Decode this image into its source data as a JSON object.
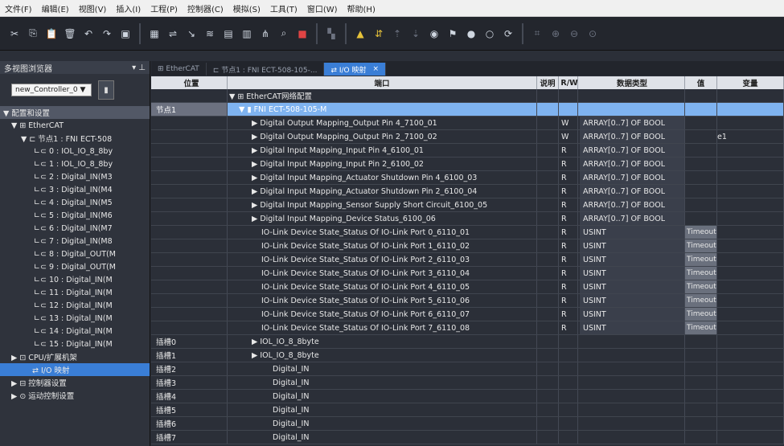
{
  "menu": [
    "文件(F)",
    "编辑(E)",
    "视图(V)",
    "插入(I)",
    "工程(P)",
    "控制器(C)",
    "模拟(S)",
    "工具(T)",
    "窗口(W)",
    "帮助(H)"
  ],
  "toolbar_icons": [
    "cut-icon",
    "copy-icon",
    "paste-icon",
    "delete-icon",
    "undo-icon",
    "redo-icon",
    "save-icon",
    "sep",
    "grid-icon",
    "cross-ref-icon",
    "jump-icon",
    "compare-icon",
    "build-icon",
    "program-icon",
    "hierarchy-icon",
    "find-icon",
    "stop-icon",
    "sep",
    "rebuild-icon",
    "sep",
    "warning-icon",
    "transfer-icon",
    "upload-icon",
    "download-icon",
    "monitor-icon",
    "force-icon",
    "online-icon",
    "offline-icon",
    "sync-icon",
    "sep",
    "fit-icon",
    "zoom-in-icon",
    "zoom-out-icon",
    "zoom-reset-icon"
  ],
  "sidebar": {
    "title": "多视图浏览器",
    "pin": "▾ ⊥",
    "controller": "new_Controller_0 ▼",
    "items": [
      {
        "label": "▼ 配置和设置",
        "indent": 4,
        "type": "section"
      },
      {
        "label": "▼ ⊞ EtherCAT",
        "indent": 14,
        "type": "normal"
      },
      {
        "label": "▼ ⊏ 节点1 : FNI ECT-508",
        "indent": 26,
        "type": "normal"
      },
      {
        "label": "∟⊂ 0 : IOL_IO_8_8by",
        "indent": 42,
        "type": "normal"
      },
      {
        "label": "∟⊂ 1 : IOL_IO_8_8by",
        "indent": 42,
        "type": "normal"
      },
      {
        "label": "∟⊂ 2 : Digital_IN(M3",
        "indent": 42,
        "type": "normal"
      },
      {
        "label": "∟⊂ 3 : Digital_IN(M4",
        "indent": 42,
        "type": "normal"
      },
      {
        "label": "∟⊂ 4 : Digital_IN(M5",
        "indent": 42,
        "type": "normal"
      },
      {
        "label": "∟⊂ 5 : Digital_IN(M6",
        "indent": 42,
        "type": "normal"
      },
      {
        "label": "∟⊂ 6 : Digital_IN(M7",
        "indent": 42,
        "type": "normal"
      },
      {
        "label": "∟⊂ 7 : Digital_IN(M8",
        "indent": 42,
        "type": "normal"
      },
      {
        "label": "∟⊂ 8 : Digital_OUT(M",
        "indent": 42,
        "type": "normal"
      },
      {
        "label": "∟⊂ 9 : Digital_OUT(M",
        "indent": 42,
        "type": "normal"
      },
      {
        "label": "∟⊂ 10 : Digital_IN(M",
        "indent": 42,
        "type": "normal"
      },
      {
        "label": "∟⊂ 11 : Digital_IN(M",
        "indent": 42,
        "type": "normal"
      },
      {
        "label": "∟⊂ 12 : Digital_IN(M",
        "indent": 42,
        "type": "normal"
      },
      {
        "label": "∟⊂ 13 : Digital_IN(M",
        "indent": 42,
        "type": "normal"
      },
      {
        "label": "∟⊂ 14 : Digital_IN(M",
        "indent": 42,
        "type": "normal"
      },
      {
        "label": "∟⊂ 15 : Digital_IN(M",
        "indent": 42,
        "type": "normal"
      },
      {
        "label": "▶ ⊡ CPU/扩展机架",
        "indent": 14,
        "type": "normal"
      },
      {
        "label": "⇄ I/O 映射",
        "indent": 40,
        "type": "selected"
      },
      {
        "label": "▶ ⊟ 控制器设置",
        "indent": 14,
        "type": "normal"
      },
      {
        "label": "▶ ⊙ 运动控制设置",
        "indent": 14,
        "type": "normal"
      }
    ]
  },
  "tabs": [
    {
      "label": "⊞ EtherCAT",
      "active": false
    },
    {
      "label": "⊏ 节点1 : FNI ECT-508-105-...",
      "active": false
    },
    {
      "label": "⇄ I/O 映射",
      "active": true,
      "close": "×"
    }
  ],
  "grid": {
    "headers": {
      "pos": "位置",
      "port": "端口",
      "desc": "说明",
      "rw": "R/W",
      "type": "数据类型",
      "val": "值",
      "var": "变量"
    },
    "rows": [
      {
        "pos": "",
        "port": "▼ ⊞ EtherCAT网络配置",
        "indent": 2,
        "rw": "",
        "type": "",
        "val": "",
        "var": ""
      },
      {
        "pos": "节点1",
        "port": "▼ ▮ FNI ECT-508-105-M",
        "indent": 14,
        "rw": "",
        "type": "",
        "val": "",
        "var": "",
        "sel": true
      },
      {
        "pos": "",
        "port": "▶ Digital Output Mapping_Output Pin 4_7100_01",
        "indent": 30,
        "rw": "W",
        "type": "ARRAY[0..7] OF BOOL",
        "val": "",
        "var": ""
      },
      {
        "pos": "",
        "port": "▶ Digital Output Mapping_Output Pin 2_7100_02",
        "indent": 30,
        "rw": "W",
        "type": "ARRAY[0..7] OF BOOL",
        "val": "",
        "var": "e1"
      },
      {
        "pos": "",
        "port": "▶ Digital Input Mapping_Input Pin 4_6100_01",
        "indent": 30,
        "rw": "R",
        "type": "ARRAY[0..7] OF BOOL",
        "val": "",
        "var": ""
      },
      {
        "pos": "",
        "port": "▶ Digital Input Mapping_Input Pin 2_6100_02",
        "indent": 30,
        "rw": "R",
        "type": "ARRAY[0..7] OF BOOL",
        "val": "",
        "var": ""
      },
      {
        "pos": "",
        "port": "▶ Digital Input Mapping_Actuator Shutdown Pin 4_6100_03",
        "indent": 30,
        "rw": "R",
        "type": "ARRAY[0..7] OF BOOL",
        "val": "",
        "var": ""
      },
      {
        "pos": "",
        "port": "▶ Digital Input Mapping_Actuator Shutdown Pin 2_6100_04",
        "indent": 30,
        "rw": "R",
        "type": "ARRAY[0..7] OF BOOL",
        "val": "",
        "var": ""
      },
      {
        "pos": "",
        "port": "▶ Digital Input Mapping_Sensor Supply Short Circuit_6100_05",
        "indent": 30,
        "rw": "R",
        "type": "ARRAY[0..7] OF BOOL",
        "val": "",
        "var": ""
      },
      {
        "pos": "",
        "port": "▶ Digital Input Mapping_Device Status_6100_06",
        "indent": 30,
        "rw": "R",
        "type": "ARRAY[0..7] OF BOOL",
        "val": "",
        "var": ""
      },
      {
        "pos": "",
        "port": "IO-Link Device State_Status Of IO-Link Port 0_6110_01",
        "indent": 42,
        "rw": "R",
        "type": "USINT",
        "val": "Timeout",
        "var": ""
      },
      {
        "pos": "",
        "port": "IO-Link Device State_Status Of IO-Link Port 1_6110_02",
        "indent": 42,
        "rw": "R",
        "type": "USINT",
        "val": "Timeout",
        "var": ""
      },
      {
        "pos": "",
        "port": "IO-Link Device State_Status Of IO-Link Port 2_6110_03",
        "indent": 42,
        "rw": "R",
        "type": "USINT",
        "val": "Timeout",
        "var": ""
      },
      {
        "pos": "",
        "port": "IO-Link Device State_Status Of IO-Link Port 3_6110_04",
        "indent": 42,
        "rw": "R",
        "type": "USINT",
        "val": "Timeout",
        "var": ""
      },
      {
        "pos": "",
        "port": "IO-Link Device State_Status Of IO-Link Port 4_6110_05",
        "indent": 42,
        "rw": "R",
        "type": "USINT",
        "val": "Timeout",
        "var": ""
      },
      {
        "pos": "",
        "port": "IO-Link Device State_Status Of IO-Link Port 5_6110_06",
        "indent": 42,
        "rw": "R",
        "type": "USINT",
        "val": "Timeout",
        "var": ""
      },
      {
        "pos": "",
        "port": "IO-Link Device State_Status Of IO-Link Port 6_6110_07",
        "indent": 42,
        "rw": "R",
        "type": "USINT",
        "val": "Timeout",
        "var": ""
      },
      {
        "pos": "",
        "port": "IO-Link Device State_Status Of IO-Link Port 7_6110_08",
        "indent": 42,
        "rw": "R",
        "type": "USINT",
        "val": "Timeout",
        "var": ""
      },
      {
        "pos": "插槽0",
        "port": "▶    IOL_IO_8_8byte",
        "indent": 30,
        "rw": "",
        "type": "",
        "val": "",
        "var": ""
      },
      {
        "pos": "插槽1",
        "port": "▶    IOL_IO_8_8byte",
        "indent": 30,
        "rw": "",
        "type": "",
        "val": "",
        "var": ""
      },
      {
        "pos": "插槽2",
        "port": "Digital_IN",
        "indent": 56,
        "rw": "",
        "type": "",
        "val": "",
        "var": ""
      },
      {
        "pos": "插槽3",
        "port": "Digital_IN",
        "indent": 56,
        "rw": "",
        "type": "",
        "val": "",
        "var": ""
      },
      {
        "pos": "插槽4",
        "port": "Digital_IN",
        "indent": 56,
        "rw": "",
        "type": "",
        "val": "",
        "var": ""
      },
      {
        "pos": "插槽5",
        "port": "Digital_IN",
        "indent": 56,
        "rw": "",
        "type": "",
        "val": "",
        "var": ""
      },
      {
        "pos": "插槽6",
        "port": "Digital_IN",
        "indent": 56,
        "rw": "",
        "type": "",
        "val": "",
        "var": ""
      },
      {
        "pos": "插槽7",
        "port": "Digital_IN",
        "indent": 56,
        "rw": "",
        "type": "",
        "val": "",
        "var": ""
      }
    ]
  },
  "colors": {
    "accent": "#3a7ed6",
    "selected_row": "#7fb3f0",
    "timeout_bg": "#6a707d"
  }
}
